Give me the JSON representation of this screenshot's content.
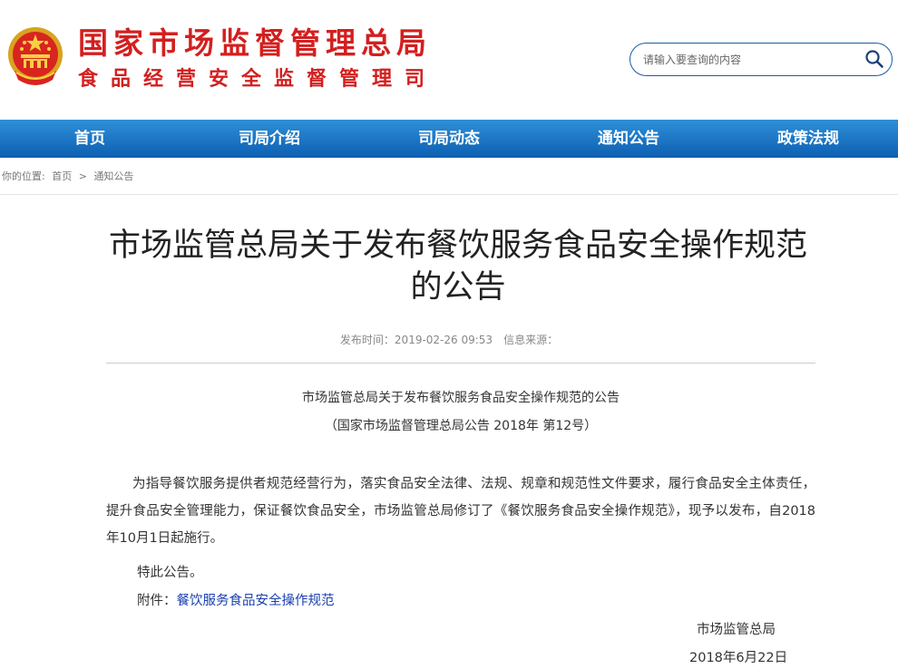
{
  "header": {
    "title": "国家市场监督管理总局",
    "subtitle": "食品经营安全监督管理司"
  },
  "search": {
    "placeholder": "请输入要查询的内容"
  },
  "nav": {
    "items": [
      "首页",
      "司局介绍",
      "司局动态",
      "通知公告",
      "政策法规"
    ]
  },
  "breadcrumb": {
    "label": "你的位置:",
    "home": "首页",
    "sep": ">",
    "current": "通知公告"
  },
  "article": {
    "title": "市场监管总局关于发布餐饮服务食品安全操作规范的公告",
    "publish_time": "发布时间：2019-02-26 09:53",
    "source": "信息来源：",
    "doc_title": "市场监管总局关于发布餐饮服务食品安全操作规范的公告",
    "doc_number": "（国家市场监督管理总局公告 2018年 第12号）",
    "paragraph": "为指导餐饮服务提供者规范经营行为，落实食品安全法律、法规、规章和规范性文件要求，履行食品安全主体责任，提升食品安全管理能力，保证餐饮食品安全，市场监管总局修订了《餐饮服务食品安全操作规范》，现予以发布，自2018年10月1日起施行。",
    "notice": "特此公告。",
    "attachment_label": "附件：",
    "attachment_link": "餐饮服务食品安全操作规范",
    "sign_org": "市场监管总局",
    "sign_date": "2018年6月22日"
  },
  "colors": {
    "brand_red": "#d31f1f",
    "nav_blue": "#1a6fc4",
    "link_blue": "#1a3fb0"
  }
}
